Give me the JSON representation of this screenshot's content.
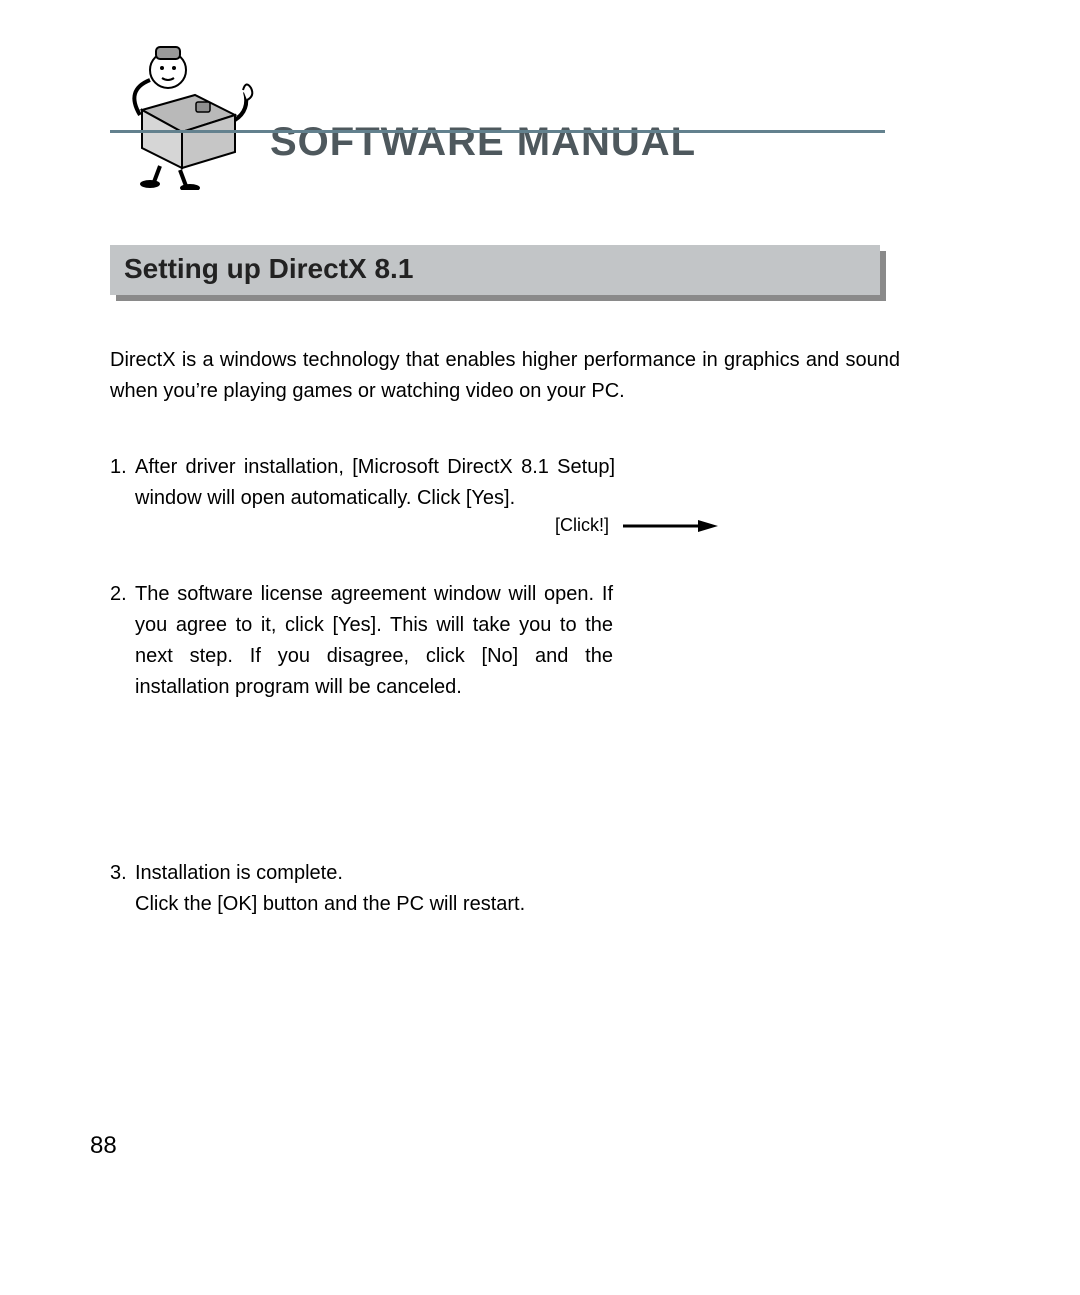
{
  "doc_title": "SOFTWARE MANUAL",
  "section_title": "Setting up DirectX 8.1",
  "intro": "DirectX is a windows technology that enables higher performance in graphics and sound when you’re playing games or watching video on your PC.",
  "steps": {
    "s1_num": "1.",
    "s1_text": "After driver installation, [Microsoft DirectX 8.1 Setup] window will open automatically. Click [Yes].",
    "s1_click": "[Click!]",
    "s2_num": "2.",
    "s2_text": "The software license agreement window will open. If you agree to it, click [Yes]. This will take you to the next step. If you disagree, click [No] and the installation program will be canceled.",
    "s3_num": "3.",
    "s3_line1": "Installation is complete.",
    "s3_line2": "Click the [OK] button and the PC will restart."
  },
  "page_number": "88"
}
